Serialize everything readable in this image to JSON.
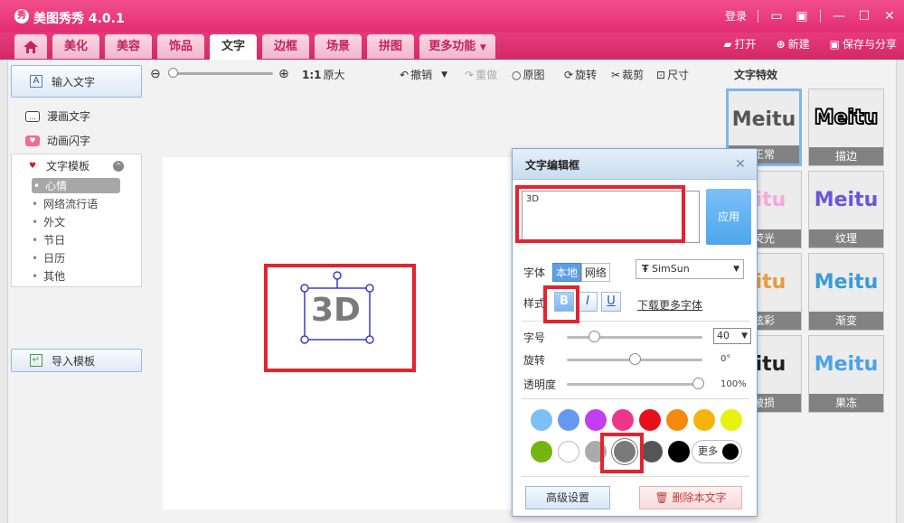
{
  "app": {
    "title": "美图秀秀 4.0.1",
    "login": "登录"
  },
  "tabs": [
    {
      "label": "美化"
    },
    {
      "label": "美容"
    },
    {
      "label": "饰品"
    },
    {
      "label": "文字",
      "active": true
    },
    {
      "label": "边框"
    },
    {
      "label": "场景"
    },
    {
      "label": "拼图"
    },
    {
      "label": "更多功能"
    }
  ],
  "toolbar_right": {
    "open": "打开",
    "new": "新建",
    "save": "保存与分享"
  },
  "left_panel": {
    "input_text": "输入文字",
    "comic_text": "漫画文字",
    "animated_text": "动画闪字",
    "template_group": "文字模板",
    "templates": [
      "心情",
      "网络流行语",
      "外文",
      "节日",
      "日历",
      "其他"
    ],
    "import_template": "导入模板"
  },
  "canvas_bar": {
    "zoom_ratio": "1:1",
    "original_size": "原大",
    "undo": "撤销",
    "redo": "重做",
    "original": "原图",
    "rotate": "旋转",
    "crop": "裁剪",
    "dimension": "尺寸"
  },
  "canvas": {
    "text": "3D"
  },
  "effects": {
    "title": "文字特效",
    "items": [
      {
        "preview": "Meitu",
        "label": "正常"
      },
      {
        "preview": "Meitu",
        "label": "描边"
      },
      {
        "preview": "eitu",
        "label": "荧光"
      },
      {
        "preview": "Meitu",
        "label": "纹理"
      },
      {
        "preview": "eitu",
        "label": "炫彩"
      },
      {
        "preview": "Meitu",
        "label": "渐变"
      },
      {
        "preview": "eitu",
        "label": "破损"
      },
      {
        "preview": "Meitu",
        "label": "果冻"
      }
    ]
  },
  "dialog": {
    "title": "文字编辑框",
    "text_value": "3D",
    "apply": "应用",
    "font_label": "字体",
    "font_local": "本地",
    "font_network": "网络",
    "font_name": "SimSun",
    "style_label": "样式",
    "bold": "B",
    "italic": "I",
    "underline": "U",
    "download_fonts": "下载更多字体",
    "size_label": "字号",
    "size_value": "40",
    "rotate_label": "旋转",
    "rotate_value": "0°",
    "opacity_label": "透明度",
    "opacity_value": "100%",
    "more": "更多",
    "advanced": "高级设置",
    "delete": "删除本文字"
  },
  "colors": {
    "accent": "#e22c72",
    "palette": [
      "#7fbff8",
      "#6798f0",
      "#c23ef0",
      "#f0368a",
      "#e6101c",
      "#f58a0c",
      "#f5b30c",
      "#e7f20e",
      "#74b514",
      "#ffffff",
      "#aaaaaa",
      "#7a7a7a",
      "#555555",
      "#000000"
    ]
  }
}
